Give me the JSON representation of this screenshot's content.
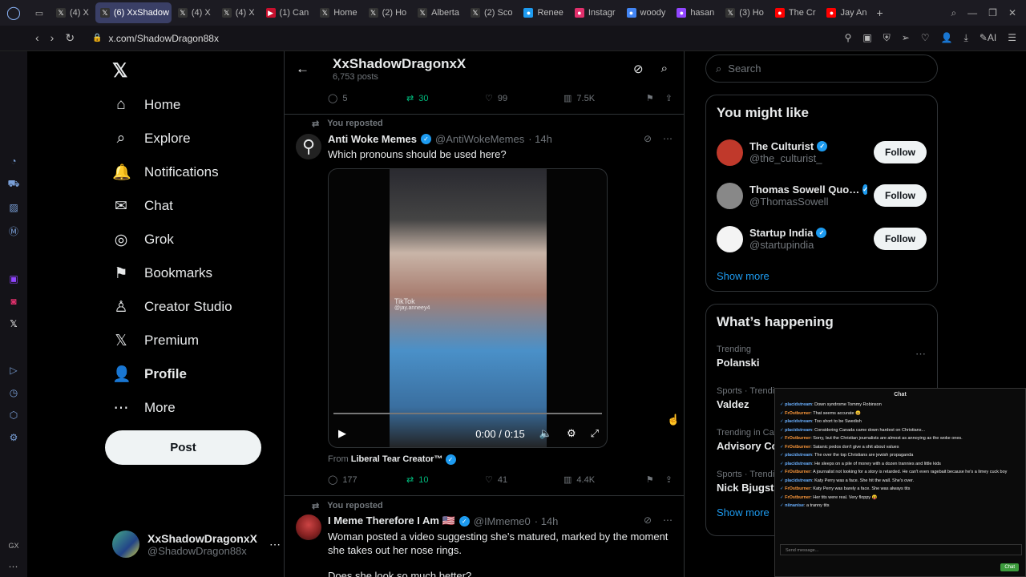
{
  "browser": {
    "tabs": [
      {
        "label": "(4) X"
      },
      {
        "label": "(6) XxShadow",
        "active": true
      },
      {
        "label": "(4) X"
      },
      {
        "label": "(4) X"
      },
      {
        "label": "(1) Can"
      },
      {
        "label": "Home"
      },
      {
        "label": "(2) Ho"
      },
      {
        "label": "Alberta"
      },
      {
        "label": "(2) Sco"
      },
      {
        "label": "Renee"
      },
      {
        "label": "Instagr"
      },
      {
        "label": "woody"
      },
      {
        "label": "hasan"
      },
      {
        "label": "(3) Ho"
      },
      {
        "label": "The Cr"
      },
      {
        "label": "Jay An"
      }
    ],
    "new_tab": "+",
    "url": "x.com/ShadowDragon88x",
    "ai_label": "AI",
    "gx_label": "GX"
  },
  "nav": {
    "badge": "6",
    "items": [
      {
        "label": "Home",
        "icon": "⌂"
      },
      {
        "label": "Explore",
        "icon": "⌕"
      },
      {
        "label": "Notifications",
        "icon": "🔔"
      },
      {
        "label": "Chat",
        "icon": "✉"
      },
      {
        "label": "Grok",
        "icon": "◎"
      },
      {
        "label": "Bookmarks",
        "icon": "⚑"
      },
      {
        "label": "Creator Studio",
        "icon": "♙"
      },
      {
        "label": "Premium",
        "icon": "𝕏"
      },
      {
        "label": "Profile",
        "icon": "👤"
      },
      {
        "label": "More",
        "icon": "⋯"
      }
    ],
    "post": "Post",
    "account": {
      "name": "XxShadowDragonxX",
      "handle": "@ShadowDragon88x"
    }
  },
  "profile_header": {
    "name": "XxShadowDragonxX",
    "posts": "6,753 posts"
  },
  "tweet0": {
    "replies": "5",
    "reposts": "30",
    "likes": "99",
    "views": "7.5K"
  },
  "tweet1": {
    "reposted": "You reposted",
    "name": "Anti Woke Memes",
    "handle": "@AntiWokeMemes",
    "time": "· 14h",
    "text": "Which pronouns should be used here?",
    "watermark": "TikTok",
    "watermark_handle": "@jay.anneey4",
    "video_time": "0:00 / 0:15",
    "from_label": "From",
    "from_name": "Liberal Tear Creator™",
    "replies": "177",
    "reposts": "10",
    "likes": "41",
    "views": "4.4K"
  },
  "tweet2": {
    "reposted": "You reposted",
    "name": "I Meme Therefore I Am 🇺🇸",
    "handle": "@IMmeme0",
    "time": "· 14h",
    "text1": "Woman posted a video suggesting she’s matured, marked by the moment she takes out her nose rings.",
    "text2": "Does she look so much better?"
  },
  "search": {
    "placeholder": "Search"
  },
  "you_might_like": {
    "title": "You might like",
    "users": [
      {
        "name": "The Culturist",
        "handle": "@the_culturist_",
        "button": "Follow",
        "color": "#c0392b"
      },
      {
        "name": "Thomas Sowell Quo…",
        "handle": "@ThomasSowell",
        "button": "Follow",
        "color": "#888888"
      },
      {
        "name": "Startup India",
        "handle": "@startupindia",
        "button": "Follow",
        "color": "#f4f4f4"
      }
    ],
    "show_more": "Show more"
  },
  "whats_happening": {
    "title": "What’s happening",
    "trends": [
      {
        "category": "Trending",
        "title": "Polanski"
      },
      {
        "category": "Sports · Trendi",
        "title": "Valdez"
      },
      {
        "category": "Trending in Ca",
        "title": "Advisory Co"
      },
      {
        "category": "Sports · Trendi",
        "title": "Nick Bjugsta"
      }
    ],
    "show_more": "Show more"
  },
  "chat": {
    "title": "Chat",
    "messages": [
      {
        "user": "placidstream",
        "text": "Down syndrome Tommy Robinson"
      },
      {
        "user": "FrOstburner",
        "text": "That seems accurate 😄"
      },
      {
        "user": "placidstream",
        "text": "Too short to be Swedish"
      },
      {
        "user": "placidstream",
        "text": "Considering Canada came down hardest on Christians..."
      },
      {
        "user": "FrOstburner",
        "text": "Sorry, but the Christian journalists are almost as annoying as the woke ones."
      },
      {
        "user": "FrOstburner",
        "text": "Satanic pedos don't give a shit about values"
      },
      {
        "user": "placidstream",
        "text": "The over the top Christians are jewish propaganda"
      },
      {
        "user": "placidstream",
        "text": "He sleeps on a pile of money with a dozen trannies and little kids"
      },
      {
        "user": "FrOstburner",
        "text": "A journalist not looking for a story is retarded. He can't even ragebait because he's a limey cuck boy"
      },
      {
        "user": "placidstream",
        "text": "Katy Perry was a face. She hit the wall. She's over."
      },
      {
        "user": "FrOstburner",
        "text": "Katy Perry was barely a face. She was always tits"
      },
      {
        "user": "FrOstburner",
        "text": "Her tits were real. Very floppy 😝"
      },
      {
        "user": "niinanise",
        "text": "a tranny tits"
      }
    ],
    "input_placeholder": "Send message...",
    "send": "Chat"
  }
}
